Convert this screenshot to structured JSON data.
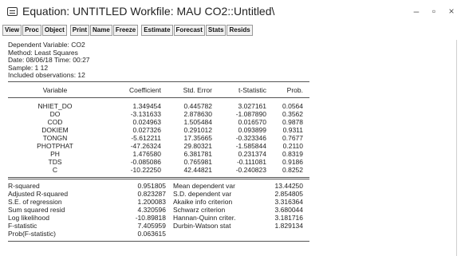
{
  "window": {
    "title": "Equation: UNTITLED   Workfile: MAU CO2::Untitled\\",
    "minimize": "–",
    "restore": "▫",
    "close": "×"
  },
  "toolbar": {
    "group1": [
      "View",
      "Proc",
      "Object"
    ],
    "group2": [
      "Print",
      "Name",
      "Freeze"
    ],
    "group3": [
      "Estimate",
      "Forecast",
      "Stats",
      "Resids"
    ]
  },
  "header": {
    "dependent": "Dependent Variable: CO2",
    "method": "Method: Least Squares",
    "date": "Date: 08/06/18   Time: 00:27",
    "sample": "Sample: 1 12",
    "included": "Included observations: 12"
  },
  "coef_table": {
    "columns": [
      "Variable",
      "Coefficient",
      "Std. Error",
      "t-Statistic",
      "Prob."
    ],
    "rows": [
      [
        "NHIET_DO",
        "1.349454",
        "0.445782",
        "3.027161",
        "0.0564"
      ],
      [
        "DO",
        "-3.131633",
        "2.878630",
        "-1.087890",
        "0.3562"
      ],
      [
        "COD",
        "0.024963",
        "1.505484",
        "0.016570",
        "0.9878"
      ],
      [
        "DOKIEM",
        "0.027326",
        "0.291012",
        "0.093899",
        "0.9311"
      ],
      [
        "TONGN",
        "-5.612211",
        "17.35665",
        "-0.323346",
        "0.7677"
      ],
      [
        "PHOTPHAT",
        "-47.26324",
        "29.80321",
        "-1.585844",
        "0.2110"
      ],
      [
        "PH",
        "1.476580",
        "6.381781",
        "0.231374",
        "0.8319"
      ],
      [
        "TDS",
        "-0.085086",
        "0.765981",
        "-0.111081",
        "0.9186"
      ],
      [
        "C",
        "-10.22250",
        "42.44821",
        "-0.240823",
        "0.8252"
      ]
    ]
  },
  "stats": [
    [
      "R-squared",
      "0.951805",
      "Mean dependent var",
      "13.44250"
    ],
    [
      "Adjusted R-squared",
      "0.823287",
      "S.D. dependent var",
      "2.854805"
    ],
    [
      "S.E. of regression",
      "1.200083",
      "Akaike info criterion",
      "3.316364"
    ],
    [
      "Sum squared resid",
      "4.320596",
      "Schwarz criterion",
      "3.680044"
    ],
    [
      "Log likelihood",
      "-10.89818",
      "Hannan-Quinn criter.",
      "3.181716"
    ],
    [
      "F-statistic",
      "7.405959",
      "Durbin-Watson stat",
      "1.829134"
    ],
    [
      "Prob(F-statistic)",
      "0.063615",
      "",
      ""
    ]
  ]
}
